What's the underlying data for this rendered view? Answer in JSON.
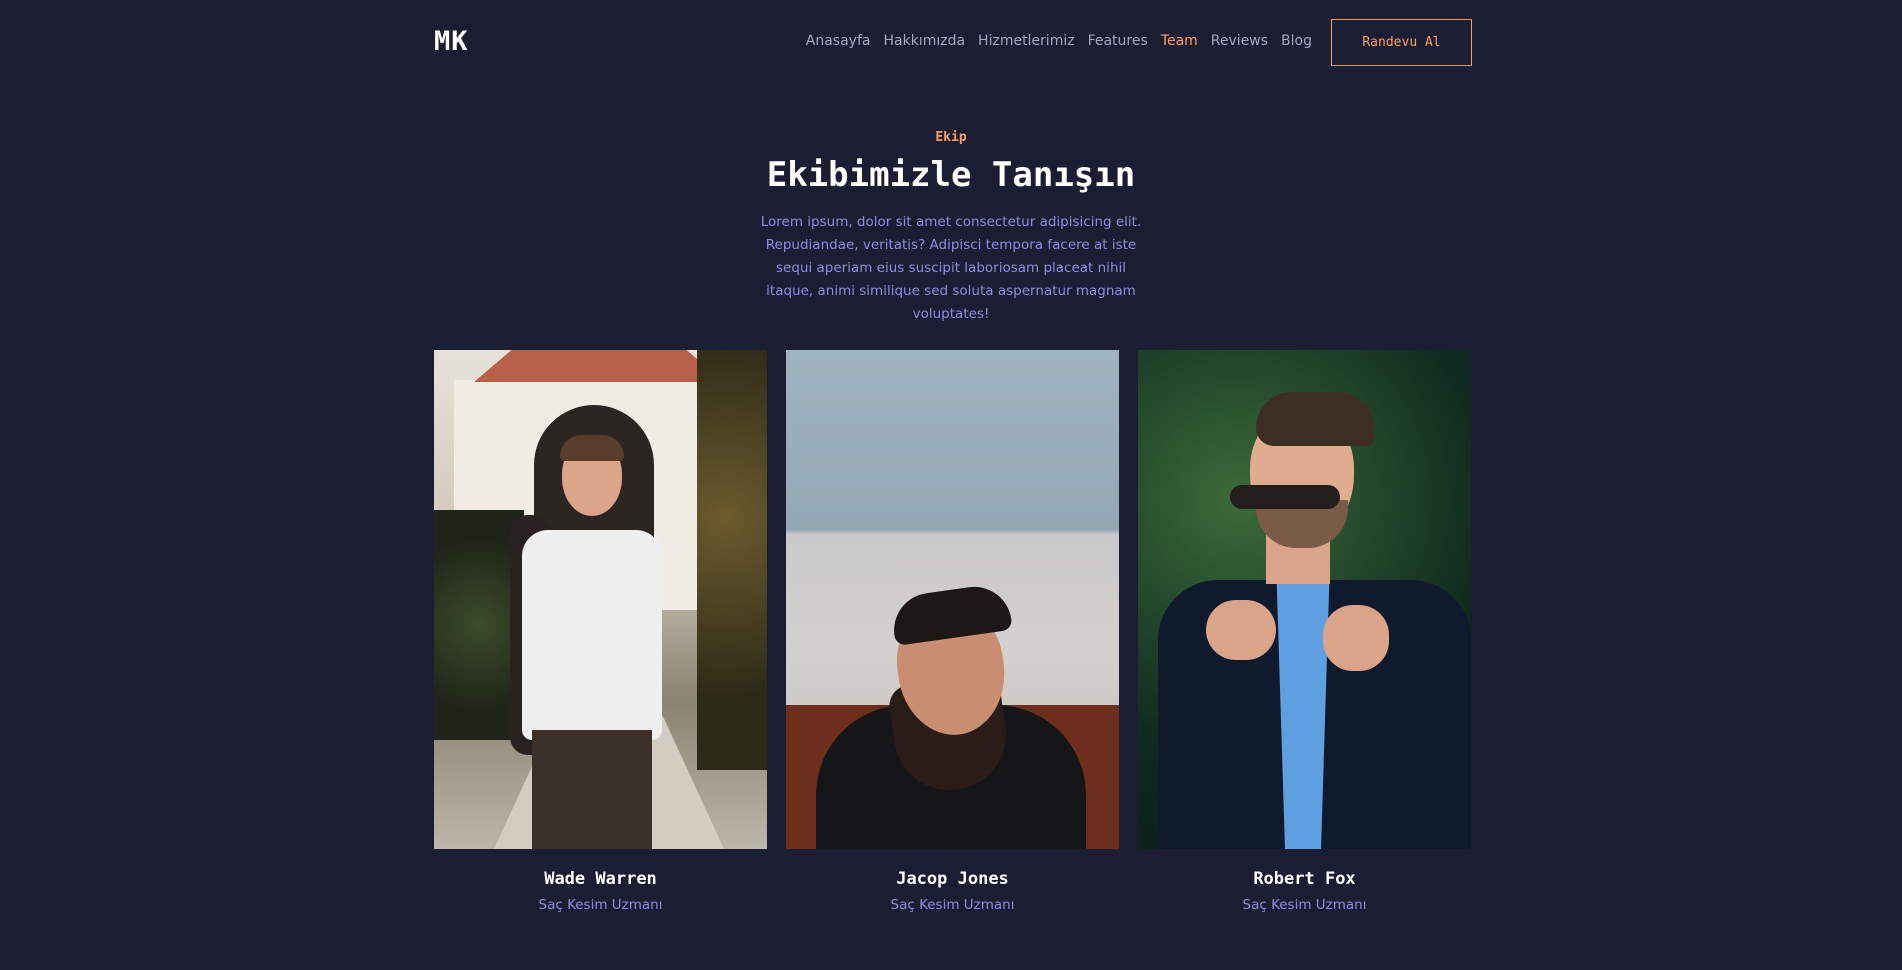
{
  "header": {
    "logo": "MK",
    "nav": [
      "Anasayfa",
      "Hakkımızda",
      "Hizmetlerimiz",
      "Features",
      "Team",
      "Reviews",
      "Blog"
    ],
    "active_nav": "Team",
    "cta_label": "Randevu Al"
  },
  "section": {
    "eyebrow": "Ekip",
    "title": "Ekibimizle Tanışın",
    "description": "Lorem ipsum, dolor sit amet consectetur adipisicing elit. Repudiandae, veritatis? Adipisci tempora facere at iste sequi aperiam eius suscipit laboriosam placeat nihil itaque, animi similique sed soluta aspernatur magnam voluptates!"
  },
  "team": [
    {
      "name": "Wade Warren",
      "role": "Saç Kesim Uzmanı"
    },
    {
      "name": "Jacop Jones",
      "role": "Saç Kesim Uzmanı"
    },
    {
      "name": "Robert Fox",
      "role": "Saç Kesim Uzmanı"
    }
  ],
  "colors": {
    "background": "#1b1e33",
    "accent": "#ff9e5c",
    "muted_text": "#8e8ce0",
    "nav_text": "#a3a7bd"
  }
}
